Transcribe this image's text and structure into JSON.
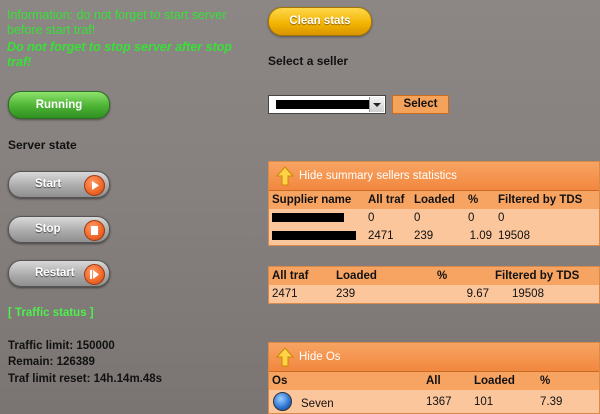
{
  "info": {
    "line1": "Information: do not forget to start server before start traf!",
    "line2": "Do not forget to stop server after stop traf!"
  },
  "status_button": "Running",
  "server_state_label": "Server state",
  "controls": {
    "start": "Start",
    "stop": "Stop",
    "restart": "Restart"
  },
  "traffic_status_label": "[ Traffic status ]",
  "traffic": {
    "limit": "Traffic limit: 150000",
    "remain": "Remain: 126389",
    "reset": "Traf limit reset: 14h.14m.48s"
  },
  "clean_stats": "Clean stats",
  "select_seller_label": "Select a seller",
  "select_button": "Select",
  "sellers_panel": {
    "toggle_label": "Hide summary sellers statistics",
    "headers": [
      "Supplier name",
      "All traf",
      "Loaded",
      "%",
      "Filtered by TDS"
    ],
    "rows": [
      [
        "0",
        "0",
        "0",
        "0"
      ],
      [
        "2471",
        "239",
        "1.09",
        "19508"
      ]
    ]
  },
  "totals_panel": {
    "headers": [
      "All traf",
      "Loaded",
      "%",
      "Filtered by TDS"
    ],
    "row": [
      "2471",
      "239",
      "9.67",
      "19508"
    ]
  },
  "os_panel": {
    "toggle_label": "Hide Os",
    "headers": [
      "Os",
      "All",
      "Loaded",
      "%"
    ],
    "rows": [
      {
        "os": "Seven",
        "icon": "windows-icon",
        "all": "1367",
        "loaded": "101",
        "percent": "7.39"
      }
    ]
  },
  "colors": {
    "accent_orange": "#f2873f",
    "info_green": "#38e038",
    "running_green": "#4cb233",
    "clean_yellow": "#f2b200"
  }
}
